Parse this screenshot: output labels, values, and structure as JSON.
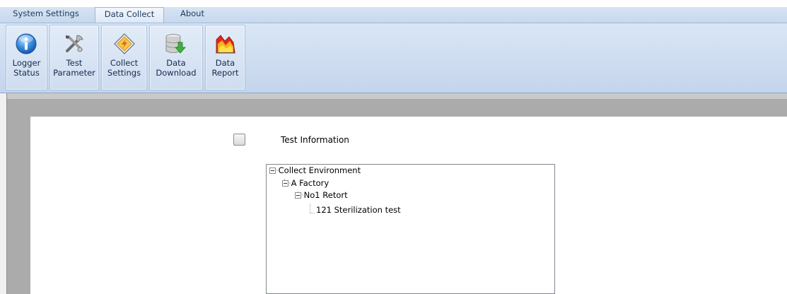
{
  "tabs": [
    {
      "label": "System Settings",
      "active": false
    },
    {
      "label": "Data Collect",
      "active": true
    },
    {
      "label": "About",
      "active": false
    }
  ],
  "ribbon": {
    "buttons": [
      {
        "line1": "Logger",
        "line2": "Status",
        "icon": "info-icon"
      },
      {
        "line1": "Test",
        "line2": "Parameter",
        "icon": "tools-icon"
      },
      {
        "line1": "Collect",
        "line2": "Settings",
        "icon": "collect-settings-icon"
      },
      {
        "line1": "Data",
        "line2": "Download",
        "icon": "database-download-icon"
      },
      {
        "line1": "Data",
        "line2": "Report",
        "icon": "report-chart-icon"
      }
    ]
  },
  "form": {
    "checkbox_label": "Test Information",
    "checkbox_checked": false
  },
  "tree": {
    "nodes": [
      {
        "label": "Collect Environment"
      },
      {
        "label": "A Factory"
      },
      {
        "label": "No1 Retort"
      },
      {
        "label": "121 Sterilization test"
      }
    ]
  },
  "colors": {
    "ribbon_bg": "#cddcf0",
    "workspace_bg": "#ababab",
    "tab_text": "#1e395b"
  }
}
